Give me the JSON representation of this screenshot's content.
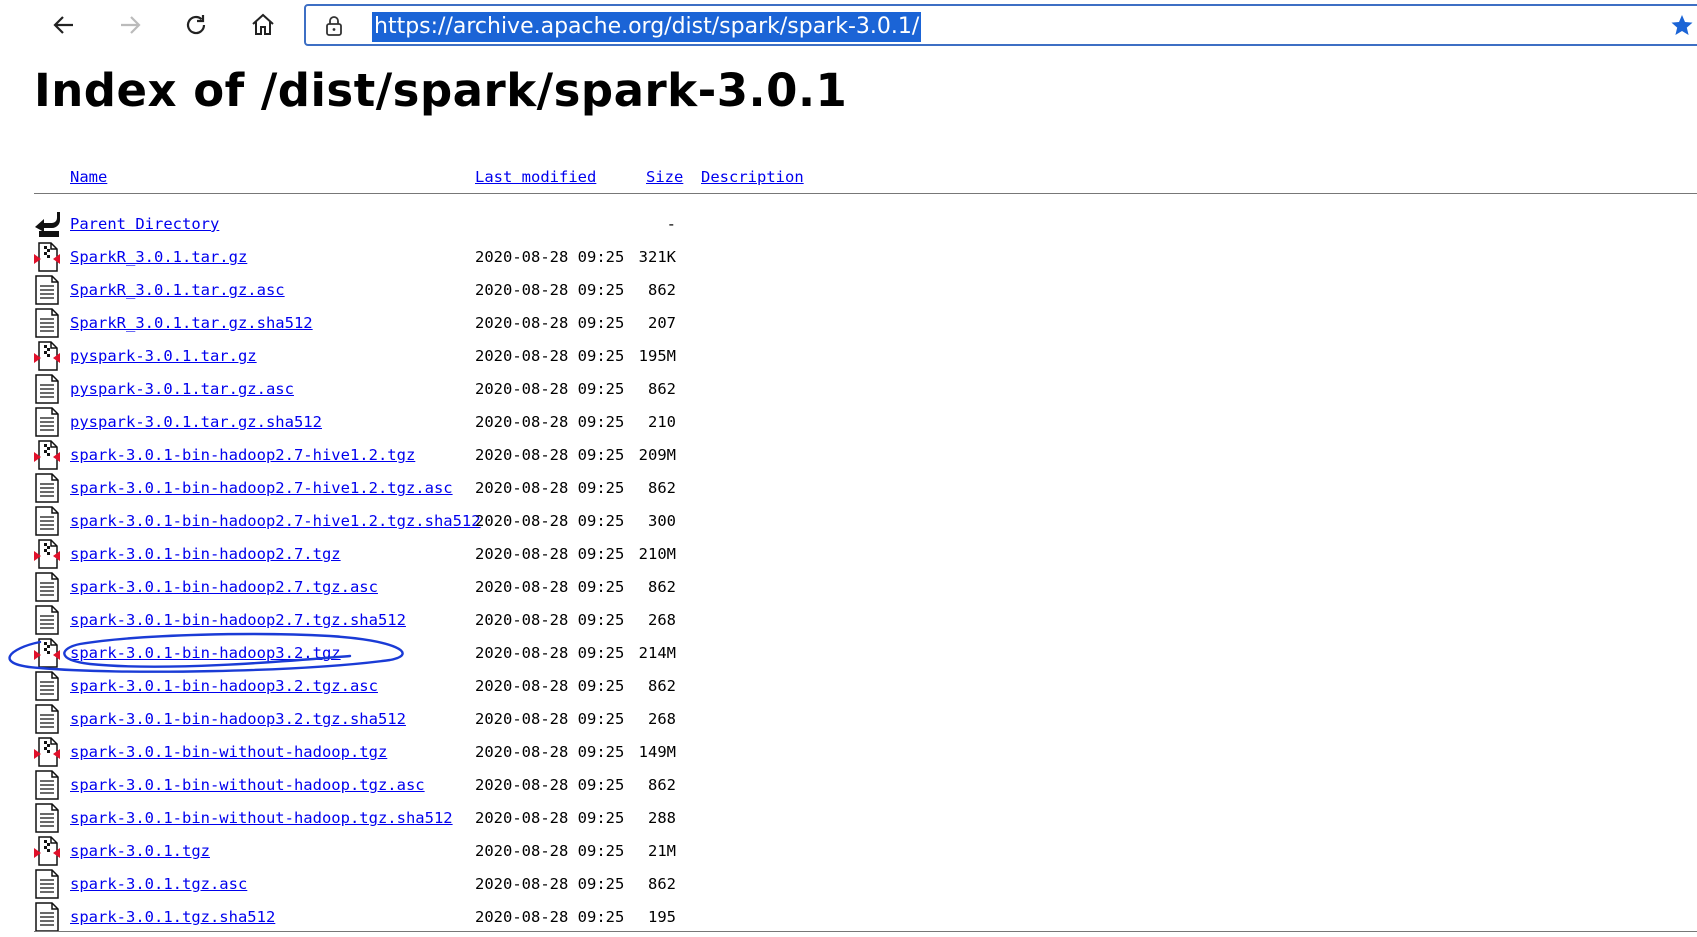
{
  "browser": {
    "url": "https://archive.apache.org/dist/spark/spark-3.0.1/",
    "back_icon": "back-arrow-icon",
    "forward_icon": "forward-arrow-icon",
    "reload_icon": "reload-icon",
    "home_icon": "home-icon",
    "lock_icon": "lock-icon",
    "star_icon": "star-icon",
    "accent": "#1b64d6"
  },
  "page": {
    "title": "Index of /dist/spark/spark-3.0.1",
    "columns": {
      "name": "Name",
      "last_modified": "Last modified",
      "size": "Size",
      "description": "Description"
    },
    "parent": {
      "label": "Parent Directory",
      "size": "-",
      "icon": "back-icon"
    },
    "files": [
      {
        "name": "SparkR_3.0.1.tar.gz",
        "modified": "2020-08-28 09:25",
        "size": "321K",
        "icon": "archive-icon"
      },
      {
        "name": "SparkR_3.0.1.tar.gz.asc",
        "modified": "2020-08-28 09:25",
        "size": "862",
        "icon": "text-file-icon"
      },
      {
        "name": "SparkR_3.0.1.tar.gz.sha512",
        "modified": "2020-08-28 09:25",
        "size": "207",
        "icon": "text-file-icon"
      },
      {
        "name": "pyspark-3.0.1.tar.gz",
        "modified": "2020-08-28 09:25",
        "size": "195M",
        "icon": "archive-icon"
      },
      {
        "name": "pyspark-3.0.1.tar.gz.asc",
        "modified": "2020-08-28 09:25",
        "size": "862",
        "icon": "text-file-icon"
      },
      {
        "name": "pyspark-3.0.1.tar.gz.sha512",
        "modified": "2020-08-28 09:25",
        "size": "210",
        "icon": "text-file-icon"
      },
      {
        "name": "spark-3.0.1-bin-hadoop2.7-hive1.2.tgz",
        "modified": "2020-08-28 09:25",
        "size": "209M",
        "icon": "archive-icon"
      },
      {
        "name": "spark-3.0.1-bin-hadoop2.7-hive1.2.tgz.asc",
        "modified": "2020-08-28 09:25",
        "size": "862",
        "icon": "text-file-icon"
      },
      {
        "name": "spark-3.0.1-bin-hadoop2.7-hive1.2.tgz.sha512",
        "modified": "2020-08-28 09:25",
        "size": "300",
        "icon": "text-file-icon"
      },
      {
        "name": "spark-3.0.1-bin-hadoop2.7.tgz",
        "modified": "2020-08-28 09:25",
        "size": "210M",
        "icon": "archive-icon"
      },
      {
        "name": "spark-3.0.1-bin-hadoop2.7.tgz.asc",
        "modified": "2020-08-28 09:25",
        "size": "862",
        "icon": "text-file-icon"
      },
      {
        "name": "spark-3.0.1-bin-hadoop2.7.tgz.sha512",
        "modified": "2020-08-28 09:25",
        "size": "268",
        "icon": "text-file-icon"
      },
      {
        "name": "spark-3.0.1-bin-hadoop3.2.tgz",
        "modified": "2020-08-28 09:25",
        "size": "214M",
        "icon": "archive-icon"
      },
      {
        "name": "spark-3.0.1-bin-hadoop3.2.tgz.asc",
        "modified": "2020-08-28 09:25",
        "size": "862",
        "icon": "text-file-icon"
      },
      {
        "name": "spark-3.0.1-bin-hadoop3.2.tgz.sha512",
        "modified": "2020-08-28 09:25",
        "size": "268",
        "icon": "text-file-icon"
      },
      {
        "name": "spark-3.0.1-bin-without-hadoop.tgz",
        "modified": "2020-08-28 09:25",
        "size": "149M",
        "icon": "archive-icon"
      },
      {
        "name": "spark-3.0.1-bin-without-hadoop.tgz.asc",
        "modified": "2020-08-28 09:25",
        "size": "862",
        "icon": "text-file-icon"
      },
      {
        "name": "spark-3.0.1-bin-without-hadoop.tgz.sha512",
        "modified": "2020-08-28 09:25",
        "size": "288",
        "icon": "text-file-icon"
      },
      {
        "name": "spark-3.0.1.tgz",
        "modified": "2020-08-28 09:25",
        "size": "21M",
        "icon": "archive-icon"
      },
      {
        "name": "spark-3.0.1.tgz.asc",
        "modified": "2020-08-28 09:25",
        "size": "862",
        "icon": "text-file-icon"
      },
      {
        "name": "spark-3.0.1.tgz.sha512",
        "modified": "2020-08-28 09:25",
        "size": "195",
        "icon": "text-file-icon"
      }
    ],
    "link_color": "#0000ee",
    "annotation_color": "#1a3bd6"
  }
}
